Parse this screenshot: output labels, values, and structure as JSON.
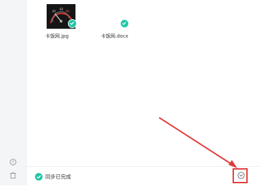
{
  "files": [
    {
      "name": "卡饭网.jpg",
      "icon": "image-thumbnail",
      "synced": true
    },
    {
      "name": "卡饭网.docx",
      "icon": "document-icon",
      "synced": true
    }
  ],
  "status": {
    "text": "同步已完成",
    "icon": "check-circle-icon"
  },
  "colors": {
    "accent": "#1fc6a6",
    "annotation": "#e23b3b"
  }
}
